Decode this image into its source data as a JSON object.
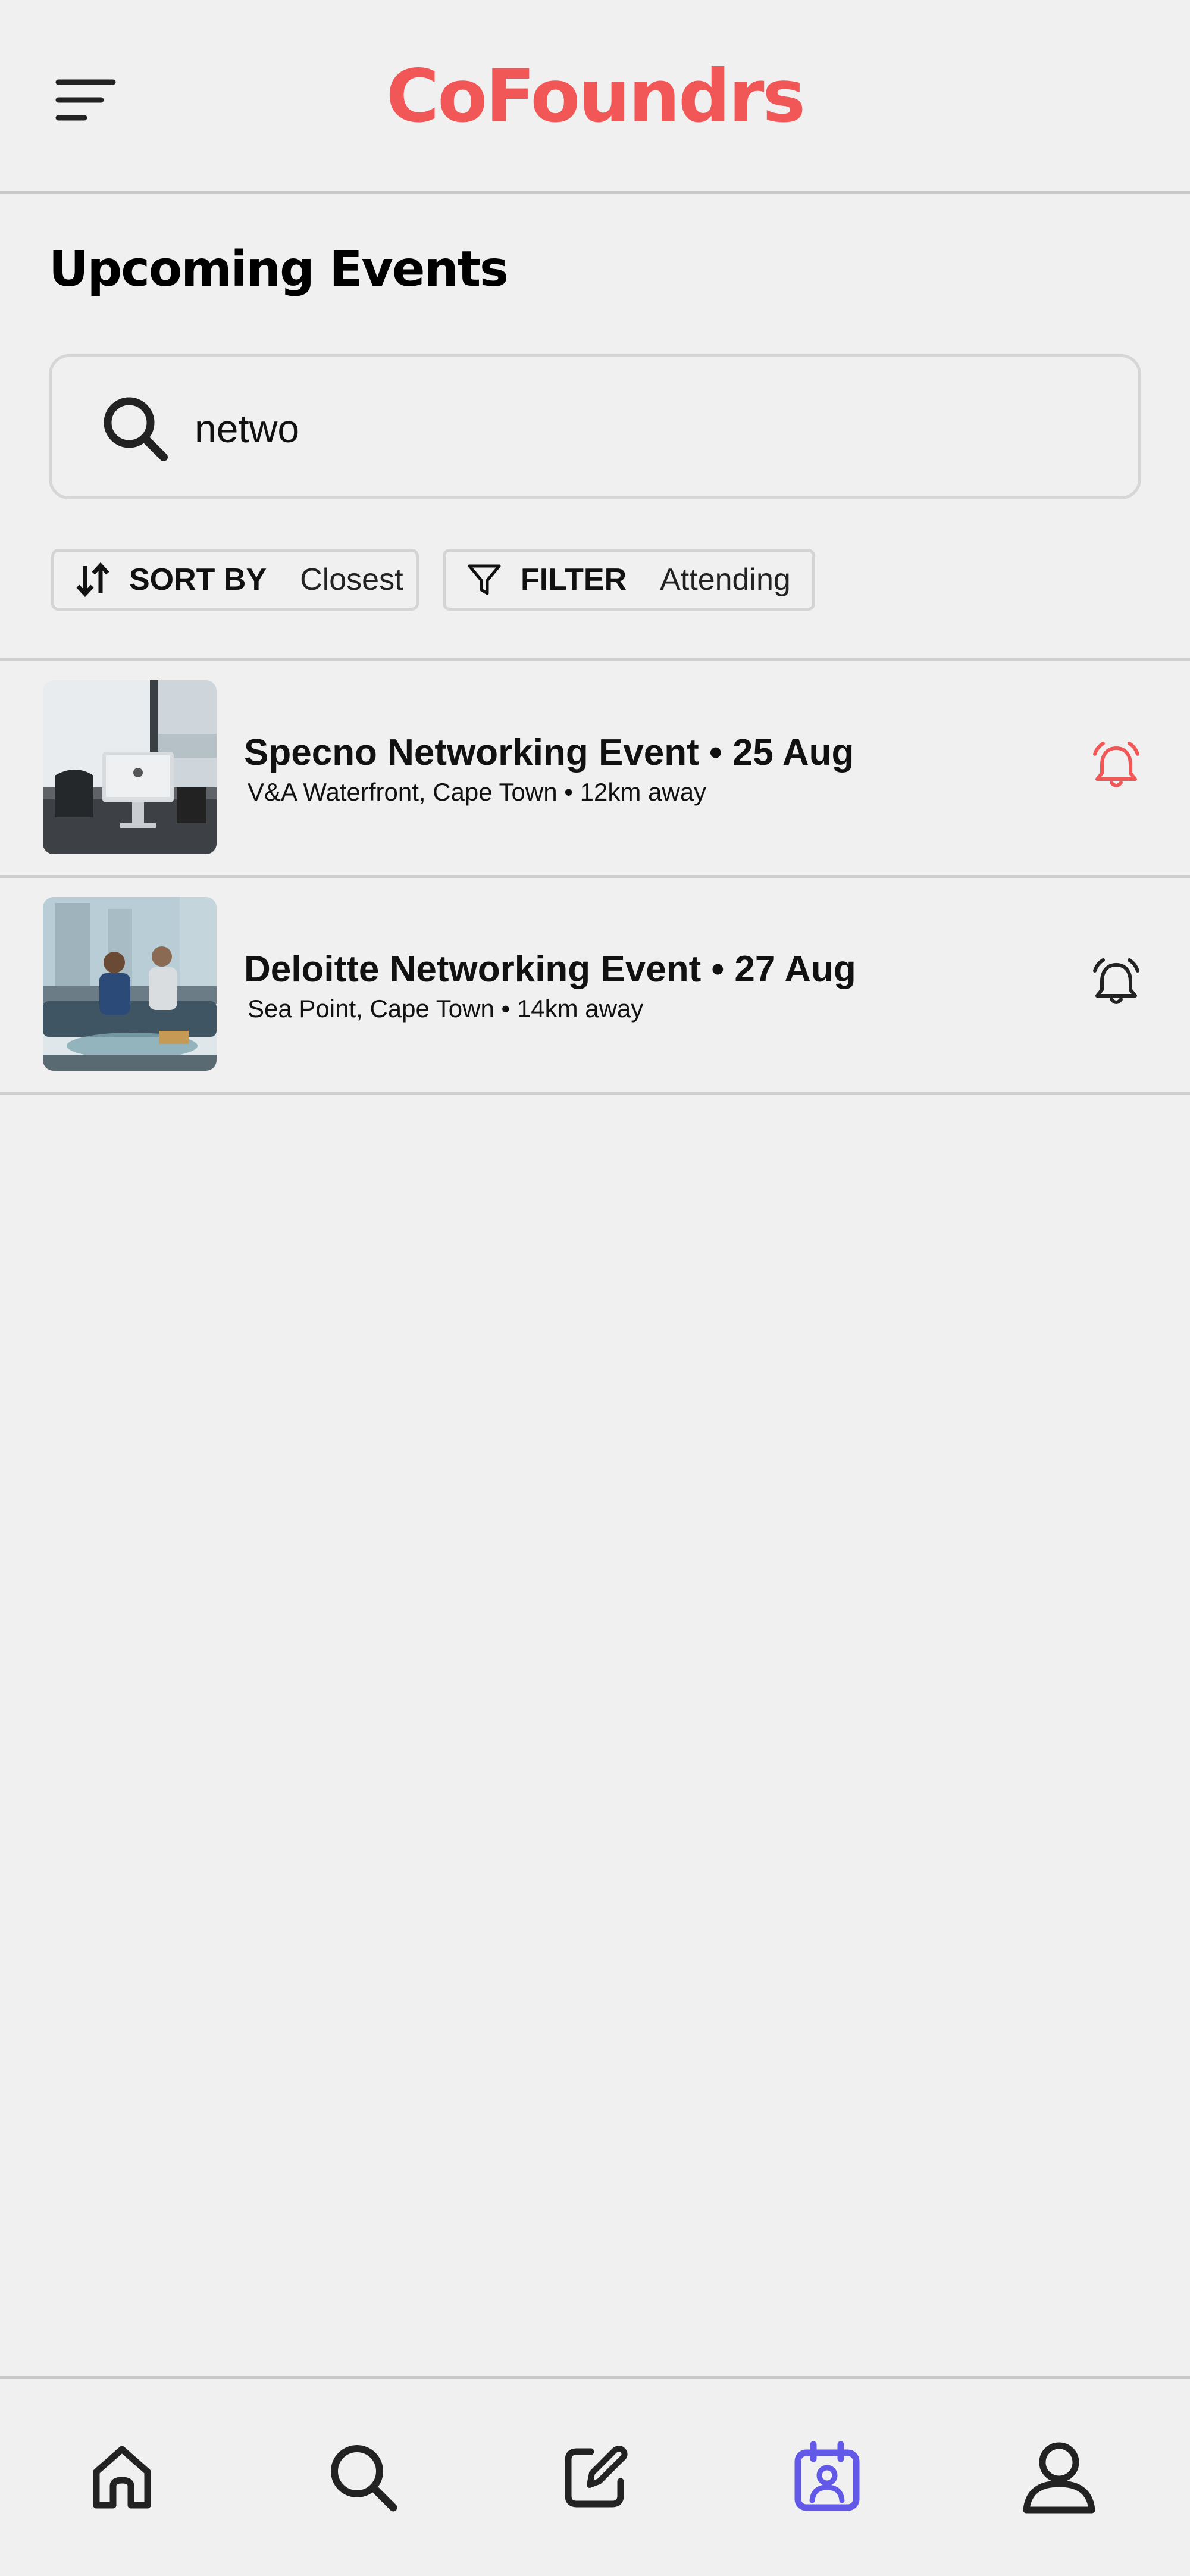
{
  "app": {
    "brand": "CoFoundrs"
  },
  "page": {
    "title": "Upcoming Events"
  },
  "search": {
    "value": "netwo"
  },
  "sort": {
    "label": "SORT BY",
    "value": "Closest"
  },
  "filter": {
    "label": "FILTER",
    "value": "Attending"
  },
  "events": [
    {
      "title": "Specno Networking Event • 25 Aug",
      "subtitle": "V&A Waterfront, Cape Town • 12km away",
      "reminder_active": true,
      "image": "office-desk-computer"
    },
    {
      "title": "Deloitte Networking Event • 27 Aug",
      "subtitle": "Sea Point, Cape Town • 14km away",
      "reminder_active": false,
      "image": "two-businessmen-on-sofa"
    }
  ],
  "nav": [
    {
      "name": "home-icon",
      "active": false
    },
    {
      "name": "search-icon",
      "active": false
    },
    {
      "name": "edit-icon",
      "active": false
    },
    {
      "name": "events-calendar-icon",
      "active": true
    },
    {
      "name": "profile-icon",
      "active": false
    }
  ],
  "colors": {
    "brand": "#f25757",
    "active_nav": "#6259e8",
    "background": "#f0f0f0",
    "text": "#111111"
  }
}
